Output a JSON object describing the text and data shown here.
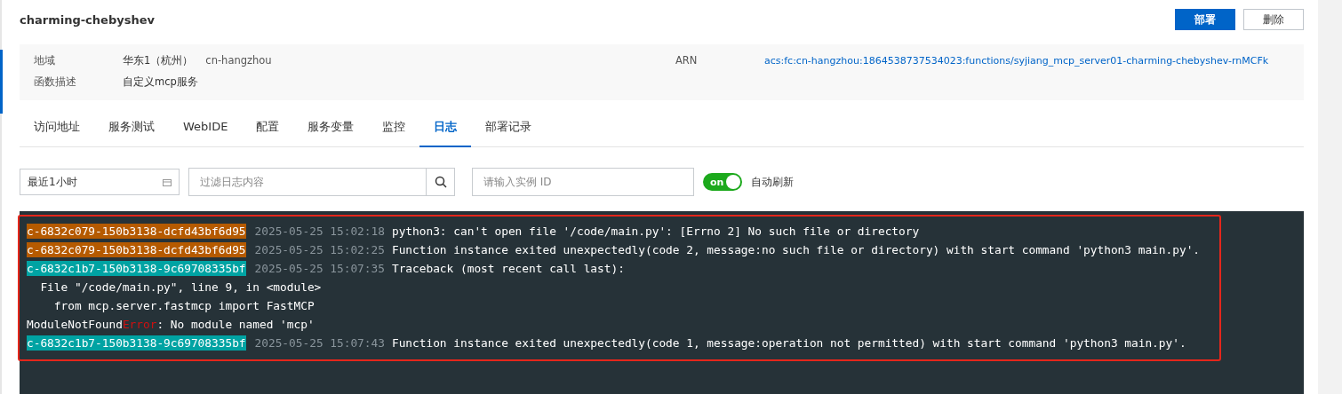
{
  "header": {
    "title": "charming-chebyshev",
    "buttons": [
      {
        "label": "部署",
        "kind": "primary"
      },
      {
        "label": "删除",
        "kind": "default"
      }
    ]
  },
  "info": {
    "region_label": "地域",
    "region_name": "华东1（杭州）",
    "region_id": "cn-hangzhou",
    "arn_label": "ARN",
    "arn_value": "acs:fc:cn-hangzhou:1864538737534023:functions/syjiang_mcp_server01-charming-chebyshev-rnMCFk",
    "desc_label": "函数描述",
    "desc_value": "自定义mcp服务"
  },
  "tabs": [
    {
      "label": "访问地址",
      "selected": false
    },
    {
      "label": "服务测试",
      "selected": false
    },
    {
      "label": "WebIDE",
      "selected": false
    },
    {
      "label": "配置",
      "selected": false
    },
    {
      "label": "服务变量",
      "selected": false
    },
    {
      "label": "监控",
      "selected": false
    },
    {
      "label": "日志",
      "selected": true
    },
    {
      "label": "部署记录",
      "selected": false
    }
  ],
  "filters": {
    "time_range": "最近1小时",
    "log_search": {
      "placeholder": "过滤日志内容"
    },
    "instance_search": {
      "placeholder": "请输入实例 ID"
    },
    "auto_refresh": {
      "on": true,
      "switch_text": "on",
      "label": "自动刷新"
    }
  },
  "logs": [
    {
      "kind": "entry",
      "instance": "c-6832c079-150b3138-dcfd43bf6d95",
      "color": "#b55a00",
      "time": "2025-05-25 15:02:18",
      "message": "python3: can't open file '/code/main.py': [Errno 2] No such file or directory"
    },
    {
      "kind": "entry",
      "instance": "c-6832c079-150b3138-dcfd43bf6d95",
      "color": "#b55a00",
      "time": "2025-05-25 15:02:25",
      "message": "Function instance exited unexpectedly(code 2, message:no such file or directory) with start command 'python3 main.py'."
    },
    {
      "kind": "entry",
      "instance": "c-6832c1b7-150b3138-9c69708335bf",
      "color": "#00a3a3",
      "time": "2025-05-25 15:07:35",
      "message": "Traceback (most recent call last):"
    },
    {
      "kind": "plain",
      "parts": [
        {
          "kind": "normal",
          "text": "  File \"/code/main.py\", line 9, in <module>"
        }
      ]
    },
    {
      "kind": "plain",
      "parts": [
        {
          "kind": "normal",
          "text": "    from mcp.server.fastmcp import FastMCP"
        }
      ]
    },
    {
      "kind": "plain",
      "parts": [
        {
          "kind": "normal",
          "text": "ModuleNotFound"
        },
        {
          "kind": "error",
          "text": "Error"
        },
        {
          "kind": "normal",
          "text": ": No module named 'mcp'"
        }
      ]
    },
    {
      "kind": "entry",
      "instance": "c-6832c1b7-150b3138-9c69708335bf",
      "color": "#00a3a3",
      "time": "2025-05-25 15:07:43",
      "message": "Function instance exited unexpectedly(code 1, message:operation not permitted) with start command 'python3 main.py'."
    }
  ]
}
